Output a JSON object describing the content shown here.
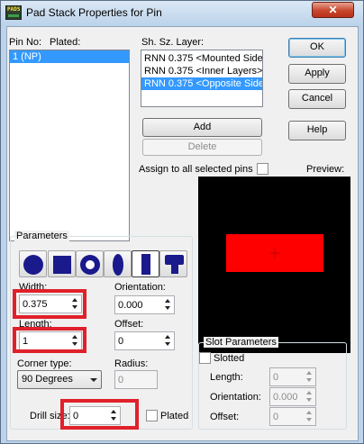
{
  "window": {
    "title": "Pad Stack Properties for Pin",
    "icon_text": "PADS",
    "close_glyph": "✕",
    "icon": "pads-app-icon"
  },
  "pin_list": {
    "col_pin_no": "Pin No:",
    "col_plated": "Plated:",
    "items": [
      "1 (NP)"
    ],
    "selected_index": 0
  },
  "layer_list": {
    "header": "Sh. Sz. Layer:",
    "items": [
      "RNN 0.375 <Mounted Side",
      "RNN 0.375 <Inner Layers>",
      "RNN 0.375 <Opposite Side"
    ],
    "selected_index": 2
  },
  "buttons": {
    "ok": "OK",
    "apply": "Apply",
    "cancel": "Cancel",
    "help": "Help",
    "add": "Add",
    "delete": "Delete"
  },
  "assign_all": {
    "label": "Assign to all selected pins",
    "checked": false
  },
  "preview": {
    "label": "Preview:",
    "background": "#000000",
    "pad_color": "#ff0000",
    "origin_marker_color": "#c00000"
  },
  "parameters": {
    "title": "Parameters",
    "shape_color": "#1a1a8c",
    "shapes": [
      "round-pad-icon",
      "square-pad-icon",
      "annular-pad-icon",
      "oval-pad-icon",
      "rectangle-pad-icon",
      "odd-shape-pad-icon"
    ],
    "active_shape_index": 4,
    "width_label": "Width:",
    "width_value": "0.375",
    "orientation_label": "Orientation:",
    "orientation_value": "0.000",
    "length_label": "Length:",
    "length_value": "1",
    "offset_label": "Offset:",
    "offset_value": "0",
    "corner_type_label": "Corner type:",
    "corner_type_value": "90 Degrees",
    "radius_label": "Radius:",
    "radius_value": "0"
  },
  "drill": {
    "label": "Drill size:",
    "value": "0",
    "plated_label": "Plated",
    "plated_checked": false
  },
  "slot_parameters": {
    "title": "Slot Parameters",
    "slotted_label": "Slotted",
    "slotted_checked": false,
    "length_label": "Length:",
    "length_value": "0",
    "orientation_label": "Orientation:",
    "orientation_value": "0.000",
    "offset_label": "Offset:",
    "offset_value": "0"
  },
  "highlight_color": "#e0202a"
}
